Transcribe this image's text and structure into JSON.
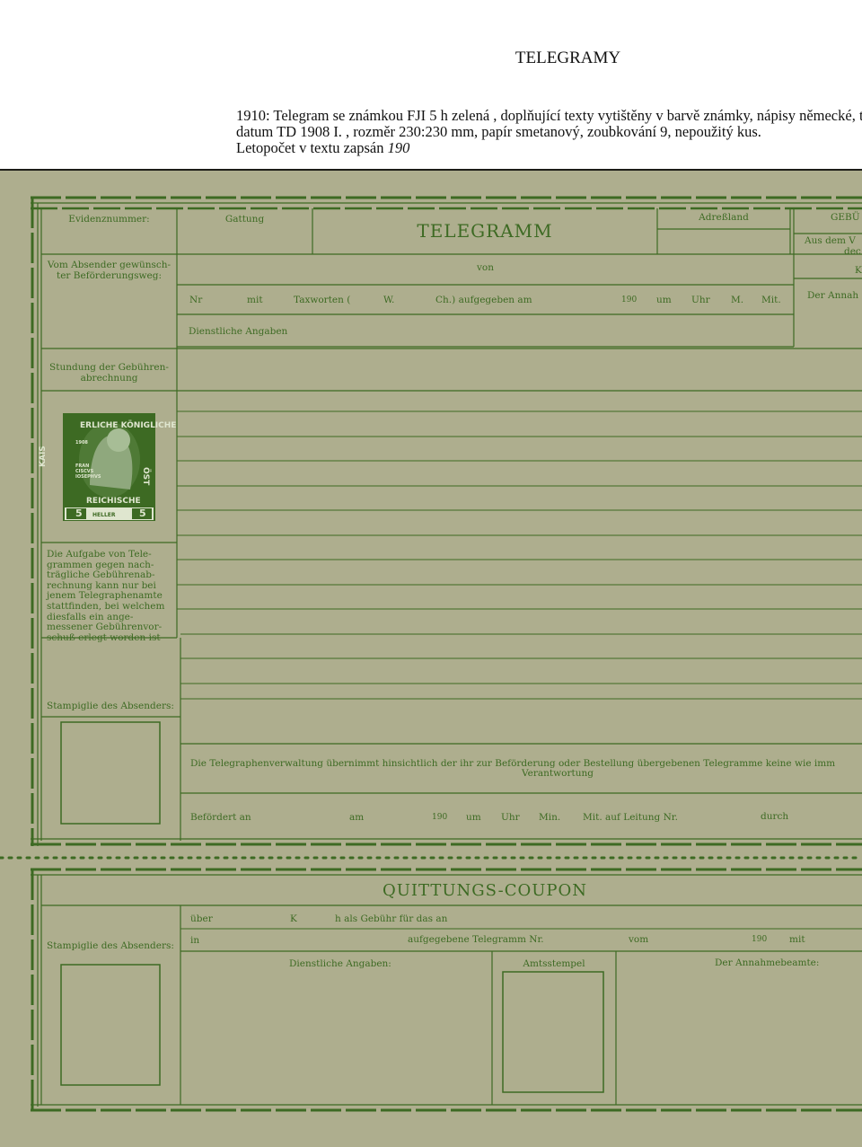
{
  "page": {
    "title": "TELEGRAMY",
    "caption": [
      "1910: Telegram se známkou FJI 5 h zelená , doplňující texty vytištěny v barvě známky, nápisy německé, tis",
      "datum  TD 1908 I. , rozměr 230:230 mm, papír smetanový, zoubkování 9, nepoužitý kus.",
      "Letopočet v textu zapsán"
    ],
    "caption_year": "190"
  },
  "form": {
    "evidenz": "Evidenznummer:",
    "gattung": "Gattung",
    "title": "TELEGRAMM",
    "adressland": "Adreßland",
    "gebuehr": "GEBÜ",
    "aus_dem": "Aus dem V",
    "dec": "dec",
    "k_cut": "K",
    "der_annahme_cut": "Der Annah",
    "vom_absender": [
      "Vom Absender gewünsch-",
      "ter Beförderungsweg:"
    ],
    "von": "von",
    "row_nr": {
      "nr": "Nr",
      "mit": "mit",
      "taxworten": "Taxworten (",
      "w": "W.",
      "ch": "Ch.) aufgegeben am",
      "year": "190",
      "um": "um",
      "uhr": "Uhr",
      "m": "M.",
      "mit2": "Mit."
    },
    "dienstliche": "Dienstliche Angaben",
    "stundung": [
      "Stundung der Gebühren-",
      "abrechnung"
    ],
    "stamp": {
      "top": "ERLICHE KÖNIGLICHE",
      "left": "KAIS",
      "right": "ÖST",
      "bottom": "REICHISCHE",
      "value_left": "5",
      "value_right": "5",
      "heller": "HELLER",
      "year_left": "1908",
      "name": [
        "FRAN",
        "CISCVS",
        "IOSEPHVS"
      ],
      "colors": {
        "green": "#3d6a23",
        "light": "#dfe6cf"
      }
    },
    "aufgabe_note": [
      "Die  Aufgabe  von  Tele-",
      "grammen  gegen  nach-",
      "trägliche  Gebührenab-",
      "rechnung  kann  nur  bei",
      "jenem  Telegraphenamte",
      "stattfinden, bei welchem",
      "diesfalls   ein   ange-",
      "messener Gebührenvor-",
      "schuß erlegt worden ist"
    ],
    "stampiglie": "Stampiglie des Absenders:",
    "verwaltung_line1": "Die Telegraphenverwaltung übernimmt hinsichtlich der ihr zur Beförderung oder Bestellung übergebenen Telegramme keine wie imm",
    "verwaltung_line2": "Verantwortung",
    "befoerdert": {
      "label": "Befördert an",
      "am": "am",
      "year": "190",
      "um": "um",
      "uhr": "Uhr",
      "min": "Min.",
      "leitung": "Mit. auf Leitung Nr.",
      "durch": "durch"
    }
  },
  "coupon": {
    "title": "QUITTUNGS-COUPON",
    "ueber": "über",
    "k": "K",
    "h_text": "h   als Gebühr für das an",
    "stampiglie": "Stampiglie des Absenders:",
    "in": "in",
    "aufgegebene": "aufgegebene Telegramm Nr.",
    "vom": "vom",
    "year": "190",
    "mit": "mit",
    "dienstliche": "Dienstliche Angaben:",
    "amtsstempel": "Amtsstempel",
    "annahmebeamte": "Der Annahmebeamte:"
  },
  "colors": {
    "paper": "#aeae8e",
    "ink": "#3d6a23"
  }
}
